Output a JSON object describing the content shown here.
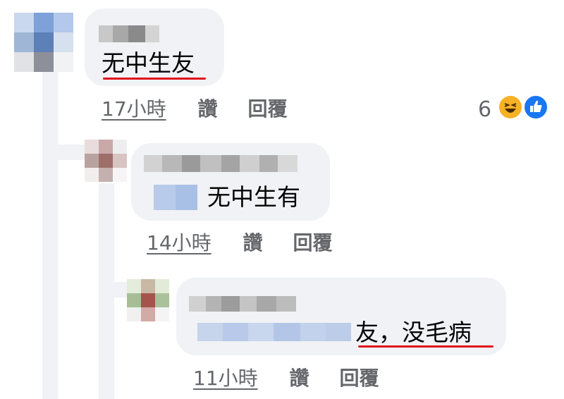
{
  "comments": [
    {
      "id": "c1",
      "author": "",
      "text": "无中生友",
      "time": "17小時",
      "like_label": "讚",
      "reply_label": "回覆",
      "reaction_count": "6",
      "reactions": [
        "haha-icon",
        "like-icon"
      ]
    },
    {
      "id": "c2",
      "author": "",
      "text": "无中生有",
      "time": "14小時",
      "like_label": "讚",
      "reply_label": "回覆"
    },
    {
      "id": "c3",
      "author": "",
      "text": "友，没毛病",
      "time": "11小時",
      "like_label": "讚",
      "reply_label": "回覆"
    }
  ],
  "colors": {
    "bubble": "#f0f2f5",
    "meta": "#65676b",
    "underline": "#e0101a",
    "like": "#1877f2",
    "haha": "#f7b125"
  }
}
